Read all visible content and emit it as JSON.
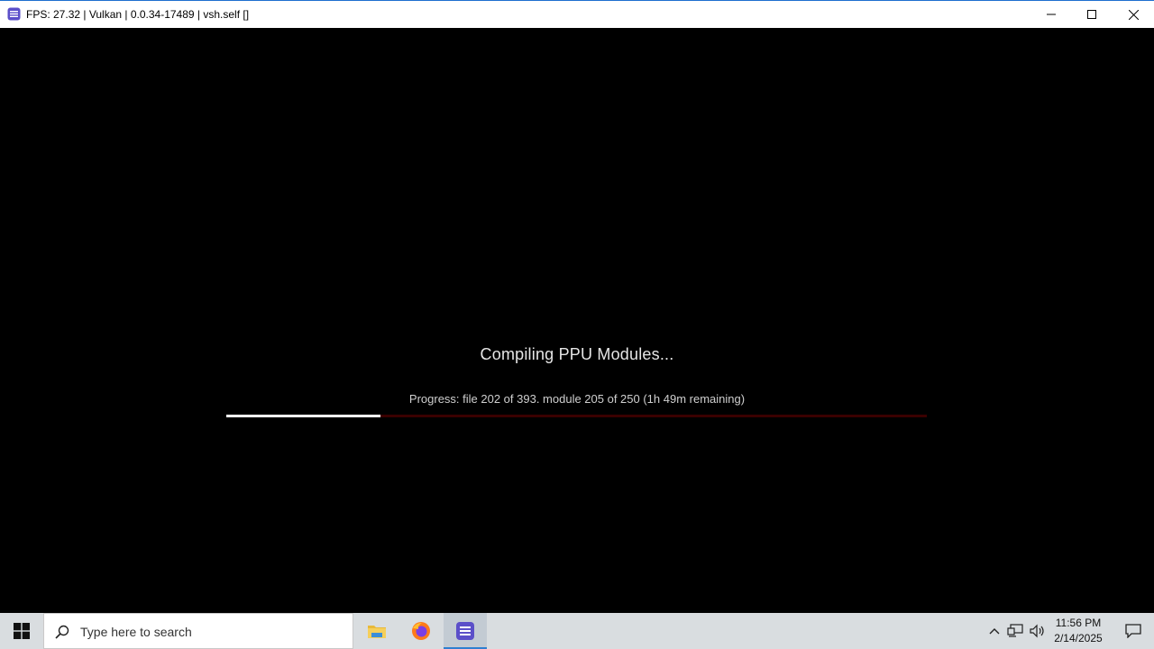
{
  "window": {
    "title": "FPS: 27.32 | Vulkan | 0.0.34-17489 | vsh.self []",
    "icons": {
      "app": "rpcs3-app-icon",
      "minimize": "minimize-icon",
      "maximize": "maximize-icon",
      "close": "close-icon"
    }
  },
  "compile": {
    "title": "Compiling PPU Modules...",
    "progress_text": "Progress: file 202 of 393. module 205 of 250 (1h 49m remaining)",
    "progress_fraction": 0.22,
    "bar_fill_color": "#ffffff",
    "bar_track_color": "#3a0000"
  },
  "taskbar": {
    "search_placeholder": "Type here to search",
    "apps": [
      "file-explorer-icon",
      "firefox-icon",
      "rpcs3-icon"
    ],
    "time": "11:56 PM",
    "date": "2/14/2025",
    "accent": "#2f7fd0"
  }
}
